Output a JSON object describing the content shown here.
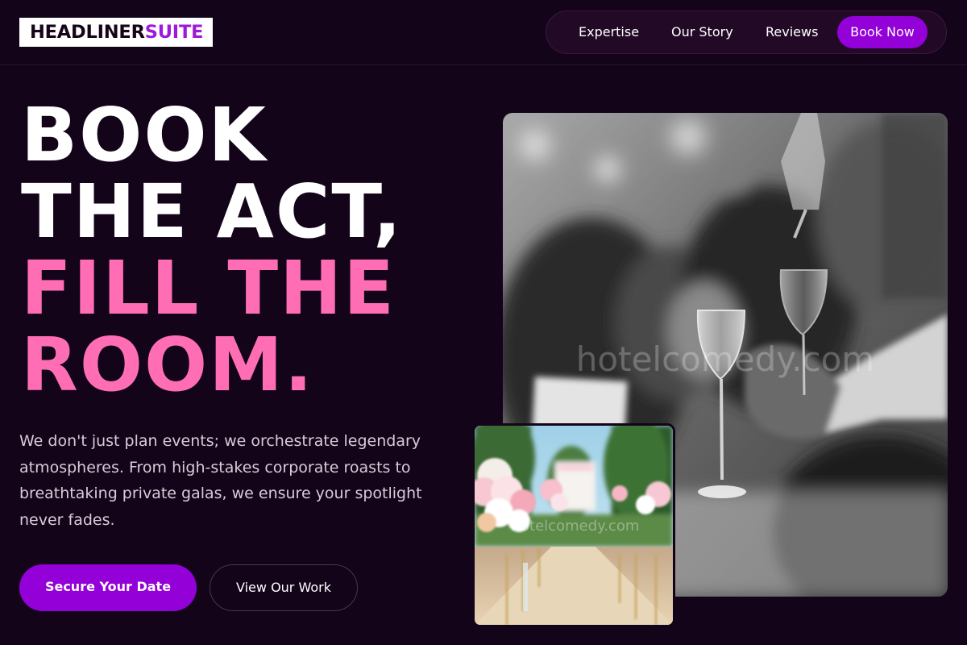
{
  "brand": {
    "part1": "HEADLINER",
    "part2": "SUITE"
  },
  "nav": {
    "links": [
      "Expertise",
      "Our Story",
      "Reviews"
    ],
    "cta": "Book Now"
  },
  "hero": {
    "headline": [
      "BOOK",
      "THE ACT,",
      "FILL THE",
      "ROOM."
    ],
    "intro": "We don't just plan events; we orchestrate legendary atmospheres. From high-stakes corporate roasts to breathtaking private galas, we ensure your spotlight never fades.",
    "primary_cta": "Secure Your Date",
    "secondary_cta": "View Our Work"
  },
  "media": {
    "main_watermark": "hotelcomedy.com",
    "small_watermark": "hotelcomedy.com"
  },
  "colors": {
    "background": "#13041a",
    "accent_purple": "#9300d8",
    "headline_pink": "#ff6eb5",
    "nav_pill": "#220a27"
  }
}
